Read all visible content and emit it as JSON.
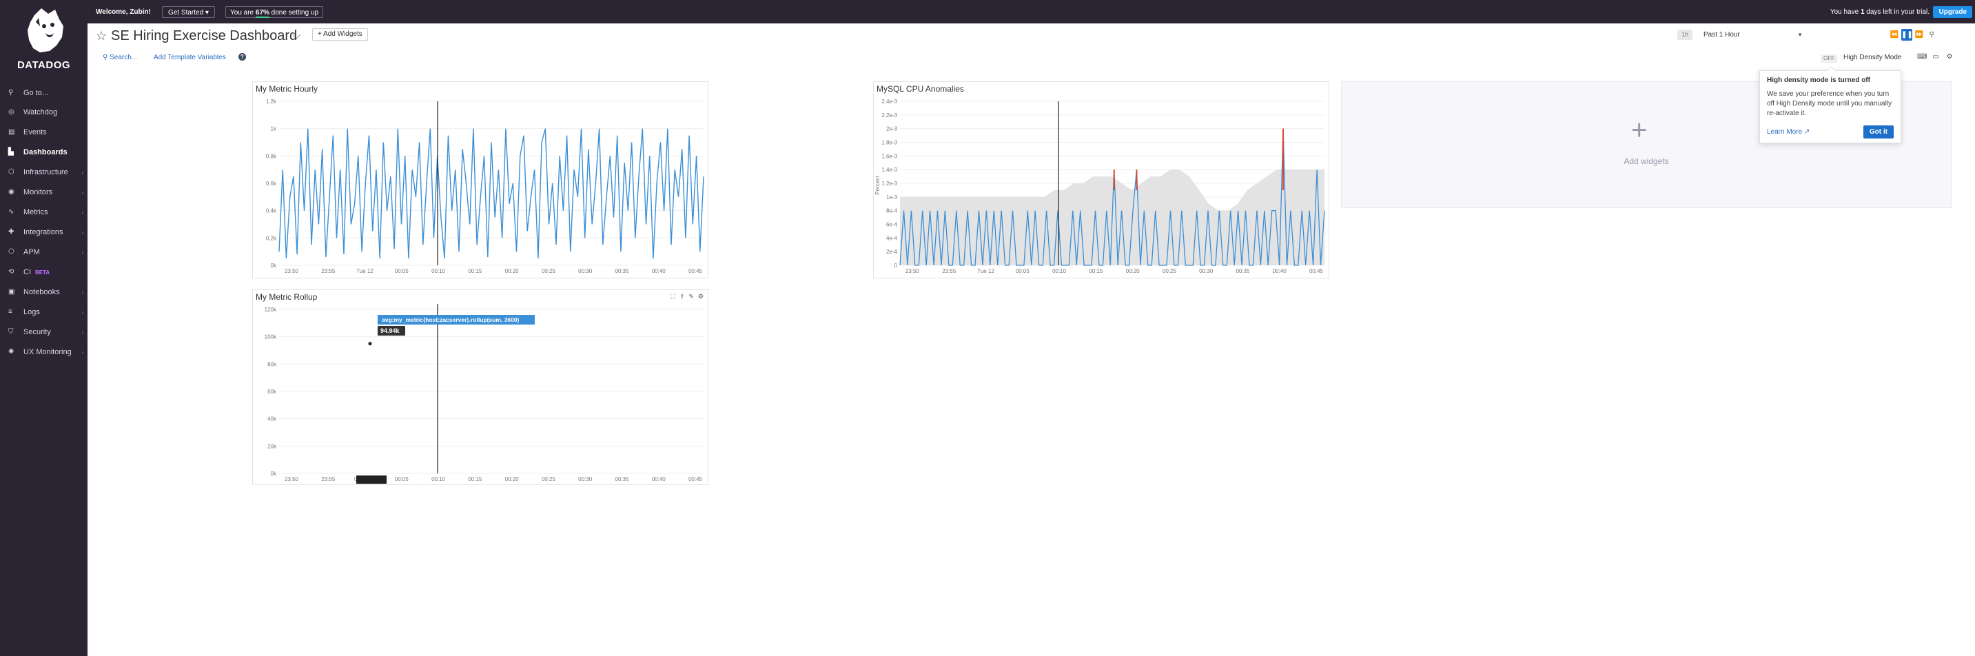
{
  "topbar": {
    "welcome": "Welcome, Zubin!",
    "get_started": "Get Started",
    "progress_prefix": "You are ",
    "progress_value": "67%",
    "progress_suffix": " done setting up",
    "trial_prefix": "You have ",
    "trial_days": "1",
    "trial_suffix": " days left in your trial.",
    "upgrade": "Upgrade"
  },
  "sidebar": {
    "logo_text": "DATADOG",
    "items": [
      {
        "label": "Go to...",
        "icon": "search-icon"
      },
      {
        "label": "Watchdog",
        "icon": "binoculars-icon"
      },
      {
        "label": "Events",
        "icon": "events-icon"
      },
      {
        "label": "Dashboards",
        "icon": "chart-icon",
        "active": true
      },
      {
        "label": "Infrastructure",
        "icon": "infra-icon"
      },
      {
        "label": "Monitors",
        "icon": "monitor-icon"
      },
      {
        "label": "Metrics",
        "icon": "metrics-icon"
      },
      {
        "label": "Integrations",
        "icon": "puzzle-icon"
      },
      {
        "label": "APM",
        "icon": "apm-icon"
      },
      {
        "label": "CI",
        "icon": "ci-icon",
        "badge": "BETA"
      },
      {
        "label": "Notebooks",
        "icon": "notebook-icon"
      },
      {
        "label": "Logs",
        "icon": "logs-icon"
      },
      {
        "label": "Security",
        "icon": "shield-icon"
      },
      {
        "label": "UX Monitoring",
        "icon": "ux-icon"
      }
    ]
  },
  "header": {
    "title": "SE Hiring Exercise Dashboard",
    "add_widgets": "+ Add Widgets",
    "search": "Search...",
    "add_template_vars": "Add Template Variables",
    "timeframe_badge": "1h",
    "timeframe": "Past 1 Hour",
    "hd_state": "OFF",
    "hd_label": "High Density Mode"
  },
  "popover": {
    "title": "High density mode is turned off",
    "body": "We save your preference when you turn off High Density mode until you manually re-activate it.",
    "learn_more": "Learn More",
    "got_it": "Got it"
  },
  "add_widgets_placeholder": "Add widgets",
  "widgets": {
    "hourly": {
      "title": "My Metric Hourly"
    },
    "mysql": {
      "title": "MySQL CPU Anomalies",
      "ylabel": "Percent"
    },
    "rollup": {
      "title": "My Metric Rollup",
      "tooltip_query": "avg:my_metric{host:zacserver}.rollup(sum, 3600)",
      "tooltip_value": "94.94k",
      "cursor_time": "00:00:00"
    }
  },
  "chart_data": [
    {
      "type": "line",
      "title": "My Metric Hourly",
      "x_ticks": [
        "23:50",
        "23:55",
        "Tue 12",
        "00:05",
        "00:10",
        "00:15",
        "00:20",
        "00:25",
        "00:30",
        "00:35",
        "00:40",
        "00:45"
      ],
      "y_ticks": [
        "0k",
        "0.2k",
        "0.4k",
        "0.6k",
        "0.8k",
        "1k",
        "1.2k"
      ],
      "ylim": [
        0,
        1200
      ],
      "color": "#3b8fd6",
      "values": [
        100,
        700,
        50,
        500,
        650,
        80,
        900,
        400,
        1000,
        150,
        700,
        300,
        850,
        60,
        500,
        950,
        200,
        700,
        80,
        1000,
        300,
        450,
        800,
        100,
        600,
        950,
        250,
        700,
        50,
        900,
        400,
        650,
        120,
        1000,
        300,
        800,
        50,
        700,
        500,
        900,
        150,
        600,
        1000,
        200,
        800,
        350,
        50,
        950,
        400,
        700,
        100,
        850,
        600,
        300,
        1000,
        150,
        500,
        800,
        60,
        900,
        350,
        700,
        200,
        1000,
        450,
        600,
        100,
        800,
        950,
        250,
        500,
        700,
        50,
        900,
        1000,
        300,
        600,
        150,
        800,
        400,
        950,
        100,
        700,
        500,
        1000,
        200,
        850,
        300,
        600,
        1000,
        150,
        500,
        800,
        350,
        950,
        100,
        750,
        400,
        900,
        200,
        650,
        1000,
        300,
        800,
        50,
        600,
        900,
        400,
        1000,
        150,
        700,
        500,
        850,
        200,
        950,
        300,
        800,
        100,
        650
      ]
    },
    {
      "type": "line",
      "title": "MySQL CPU Anomalies",
      "x_ticks": [
        "23:50",
        "23:55",
        "Tue 12",
        "00:05",
        "00:10",
        "00:15",
        "00:20",
        "00:25",
        "00:30",
        "00:35",
        "00:40",
        "00:45"
      ],
      "y_ticks": [
        "0",
        "2e-4",
        "4e-4",
        "6e-4",
        "8e-4",
        "1e-3",
        "1.2e-3",
        "1.4e-3",
        "1.6e-3",
        "1.8e-3",
        "2e-3",
        "2.2e-3",
        "2.4e-3"
      ],
      "ylim": [
        0,
        0.0024
      ],
      "ylabel": "Percent",
      "color": "#3b8fd6",
      "anomaly_color": "#e0452b",
      "band_color": "#e3e3e3",
      "band_upper": [
        0.001,
        0.001,
        0.001,
        0.001,
        0.001,
        0.001,
        0.001,
        0.001,
        0.001,
        0.001,
        0.001,
        0.001,
        0.001,
        0.001,
        0.001,
        0.001,
        0.0011,
        0.0011,
        0.0012,
        0.0012,
        0.0013,
        0.0013,
        0.0013,
        0.0012,
        0.0011,
        0.0012,
        0.0013,
        0.0013,
        0.0014,
        0.0014,
        0.0013,
        0.0011,
        0.0009,
        0.0008,
        0.0008,
        0.0009,
        0.0011,
        0.0012,
        0.0013,
        0.0014,
        0.0014,
        0.0014,
        0.0014,
        0.0014,
        0.0014
      ],
      "values": [
        0,
        0.0008,
        0,
        0.0008,
        0,
        0,
        0.0008,
        0,
        0.0008,
        0,
        0.0008,
        0,
        0.0008,
        0,
        0,
        0.0008,
        0,
        0,
        0.0008,
        0,
        0,
        0.0008,
        0,
        0.0008,
        0,
        0.0008,
        0,
        0.0008,
        0,
        0,
        0.0008,
        0,
        0,
        0,
        0.0008,
        0,
        0.0008,
        0,
        0,
        0.0008,
        0,
        0,
        0.0008,
        0,
        0,
        0,
        0.0008,
        0,
        0.0008,
        0,
        0,
        0,
        0.0008,
        0,
        0,
        0.0008,
        0,
        0.0014,
        0,
        0.0008,
        0,
        0,
        0.0008,
        0.0014,
        0,
        0.0008,
        0,
        0,
        0.0008,
        0,
        0,
        0,
        0.0008,
        0,
        0,
        0.0008,
        0,
        0,
        0,
        0.0008,
        0,
        0,
        0.0008,
        0,
        0,
        0.0008,
        0,
        0,
        0.0008,
        0,
        0.0008,
        0,
        0.0008,
        0,
        0,
        0.0008,
        0,
        0.0008,
        0,
        0.0008,
        0.0008,
        0,
        0.002,
        0,
        0.0008,
        0,
        0,
        0.0008,
        0,
        0.0008,
        0,
        0.0014,
        0,
        0.0008
      ],
      "anomaly_points": [
        57,
        63,
        102
      ]
    },
    {
      "type": "line",
      "title": "My Metric Rollup",
      "x_ticks": [
        "23:50",
        "23:55",
        "00:00:00",
        "00:05",
        "00:10",
        "00:15",
        "00:20",
        "00:25",
        "00:30",
        "00:35",
        "00:40",
        "00:45"
      ],
      "y_ticks": [
        "0k",
        "20k",
        "40k",
        "60k",
        "80k",
        "100k",
        "120k"
      ],
      "ylim": [
        0,
        120000
      ],
      "points": [
        {
          "x": "00:00:00",
          "y": 94940
        }
      ]
    }
  ]
}
